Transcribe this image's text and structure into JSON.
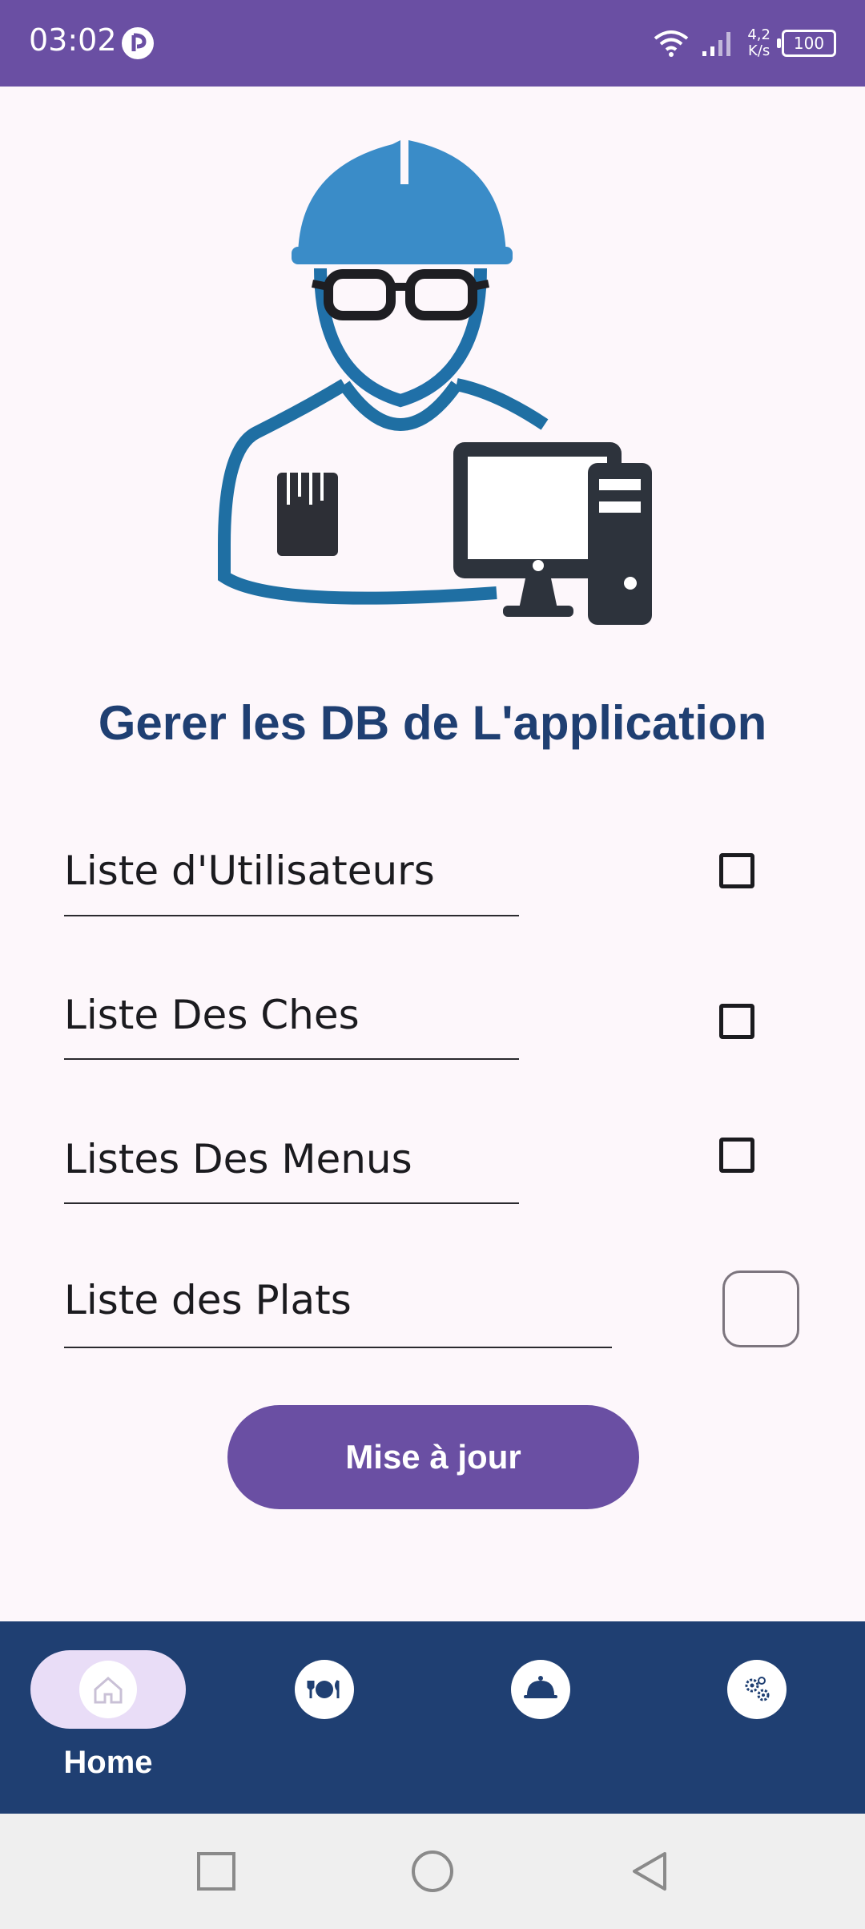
{
  "status_bar": {
    "time": "03:02",
    "net_speed_value": "4,2",
    "net_speed_unit": "K/s",
    "battery": "100",
    "color": "#6a4fa3"
  },
  "page": {
    "title": "Gerer les DB de L'application"
  },
  "db_lists": [
    {
      "label": "Liste d'Utilisateurs",
      "checked": false
    },
    {
      "label": "Liste Des Ches",
      "checked": false
    },
    {
      "label": "Listes Des Menus",
      "checked": false
    },
    {
      "label": "Liste des Plats",
      "checked": false
    }
  ],
  "update_button": {
    "label": "Mise à jour"
  },
  "bottom_nav": {
    "items": [
      {
        "label": "Home",
        "icon": "home-icon",
        "selected": true
      },
      {
        "label": "",
        "icon": "dishes-icon",
        "selected": false
      },
      {
        "label": "",
        "icon": "cloche-icon",
        "selected": false
      },
      {
        "label": "",
        "icon": "settings-gears-icon",
        "selected": false
      }
    ],
    "color": "#1f3f72"
  },
  "colors": {
    "accent": "#6a4fa3",
    "title": "#1f3f72",
    "background": "#fdf7fb"
  }
}
